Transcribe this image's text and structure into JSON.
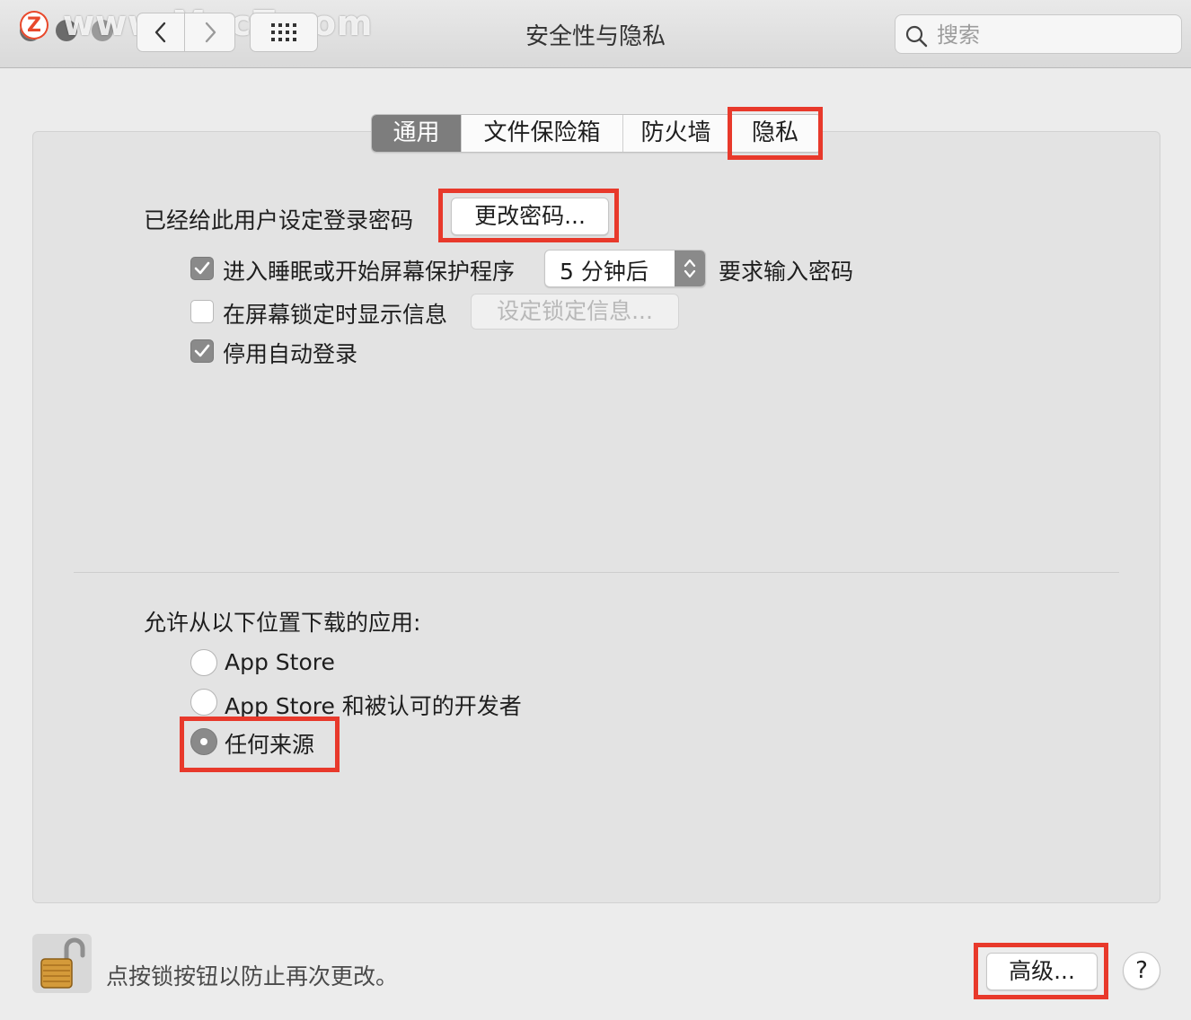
{
  "watermark": {
    "logo_letter": "Z",
    "text": "www.MacZ.com"
  },
  "window": {
    "title": "安全性与隐私"
  },
  "toolbar": {
    "back_icon": "chevron-left-icon",
    "forward_icon": "chevron-right-icon",
    "grid_icon": "grid-icon"
  },
  "search": {
    "placeholder": "搜索",
    "value": ""
  },
  "tabs": [
    {
      "label": "通用",
      "selected": true
    },
    {
      "label": "文件保险箱",
      "selected": false
    },
    {
      "label": "防火墙",
      "selected": false
    },
    {
      "label": "隐私",
      "selected": false
    }
  ],
  "general": {
    "password_label": "已经给此用户设定登录密码",
    "change_password_button": "更改密码...",
    "require_password": {
      "checked": true,
      "label": "进入睡眠或开始屏幕保护程序",
      "delay_value": "5 分钟后",
      "suffix": "要求输入密码"
    },
    "show_message": {
      "checked": false,
      "label": "在屏幕锁定时显示信息",
      "button": "设定锁定信息..."
    },
    "disable_auto_login": {
      "checked": true,
      "label": "停用自动登录"
    }
  },
  "downloads": {
    "heading": "允许从以下位置下载的应用:",
    "options": [
      {
        "label": "App Store",
        "selected": false
      },
      {
        "label": "App Store 和被认可的开发者",
        "selected": false
      },
      {
        "label": "任何来源",
        "selected": true
      }
    ]
  },
  "footer": {
    "lock_text": "点按锁按钮以防止再次更改。",
    "advanced_button": "高级...",
    "help_button": "?"
  },
  "colors": {
    "highlight": "#e8392b",
    "selected_tab": "#7d7d7d",
    "control_accent": "#8a8a8a"
  }
}
